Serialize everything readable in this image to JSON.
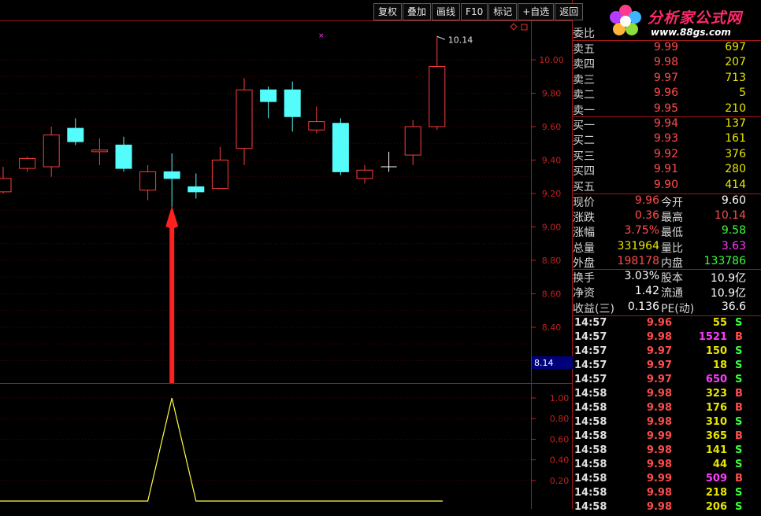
{
  "toolbar": {
    "buttons": [
      "复权",
      "叠加",
      "画线",
      "F10",
      "标记",
      "+自选",
      "返回"
    ]
  },
  "logo": {
    "title": "分析家公式网",
    "url": "www.88gs.com"
  },
  "colors": {
    "up": "#ff3c3c",
    "down": "#54fcfc",
    "grid": "#5a0000",
    "axis": "#c02020",
    "indicator": "#ffff40",
    "arrow": "#ff2020"
  },
  "main_chart": {
    "price_axis_ticks": [
      "10.00",
      "9.80",
      "9.60",
      "9.40",
      "9.20",
      "9.00",
      "8.80",
      "8.60",
      "8.40"
    ],
    "high_label": "10.14",
    "cursor_value": "8.14",
    "candles": [
      {
        "o": 9.21,
        "h": 9.36,
        "l": 9.2,
        "c": 9.29
      },
      {
        "o": 9.35,
        "h": 9.42,
        "l": 9.33,
        "c": 9.41
      },
      {
        "o": 9.36,
        "h": 9.6,
        "l": 9.3,
        "c": 9.55
      },
      {
        "o": 9.59,
        "h": 9.65,
        "l": 9.49,
        "c": 9.51
      },
      {
        "o": 9.45,
        "h": 9.53,
        "l": 9.37,
        "c": 9.46
      },
      {
        "o": 9.49,
        "h": 9.54,
        "l": 9.33,
        "c": 9.35
      },
      {
        "o": 9.22,
        "h": 9.37,
        "l": 9.16,
        "c": 9.33
      },
      {
        "o": 9.33,
        "h": 9.44,
        "l": 9.1,
        "c": 9.29
      },
      {
        "o": 9.24,
        "h": 9.32,
        "l": 9.17,
        "c": 9.21
      },
      {
        "o": 9.23,
        "h": 9.48,
        "l": 9.23,
        "c": 9.4
      },
      {
        "o": 9.47,
        "h": 9.89,
        "l": 9.37,
        "c": 9.82
      },
      {
        "o": 9.82,
        "h": 9.84,
        "l": 9.65,
        "c": 9.75
      },
      {
        "o": 9.82,
        "h": 9.87,
        "l": 9.57,
        "c": 9.66
      },
      {
        "o": 9.58,
        "h": 9.72,
        "l": 9.56,
        "c": 9.63
      },
      {
        "o": 9.62,
        "h": 9.65,
        "l": 9.31,
        "c": 9.33
      },
      {
        "o": 9.29,
        "h": 9.37,
        "l": 9.26,
        "c": 9.34
      },
      {
        "o": 9.36,
        "h": 9.45,
        "l": 9.33,
        "c": 9.36
      },
      {
        "o": 9.43,
        "h": 9.64,
        "l": 9.37,
        "c": 9.6
      },
      {
        "o": 9.6,
        "h": 10.14,
        "l": 9.58,
        "c": 9.96
      }
    ]
  },
  "indicator": {
    "axis_ticks": [
      "1.00",
      "0.80",
      "0.60",
      "0.40",
      "0.20"
    ],
    "values": [
      0,
      0,
      0,
      0,
      0,
      0,
      0,
      1,
      0,
      0,
      0,
      0,
      0,
      0,
      0,
      0,
      0,
      0,
      0
    ]
  },
  "quote": {
    "weibi_label": "委比",
    "asks": [
      {
        "label": "卖五",
        "price": "9.99",
        "vol": "697"
      },
      {
        "label": "卖四",
        "price": "9.98",
        "vol": "207"
      },
      {
        "label": "卖三",
        "price": "9.97",
        "vol": "713"
      },
      {
        "label": "卖二",
        "price": "9.96",
        "vol": "5"
      },
      {
        "label": "卖一",
        "price": "9.95",
        "vol": "210"
      }
    ],
    "bids": [
      {
        "label": "买一",
        "price": "9.94",
        "vol": "137"
      },
      {
        "label": "买二",
        "price": "9.93",
        "vol": "161"
      },
      {
        "label": "买三",
        "price": "9.92",
        "vol": "376"
      },
      {
        "label": "买四",
        "price": "9.91",
        "vol": "280"
      },
      {
        "label": "买五",
        "price": "9.90",
        "vol": "414"
      }
    ],
    "stats1": [
      {
        "l1": "现价",
        "v1": "9.96",
        "c1": "red",
        "l2": "今开",
        "v2": "9.60",
        "c2": "white"
      },
      {
        "l1": "涨跌",
        "v1": "0.36",
        "c1": "red",
        "l2": "最高",
        "v2": "10.14",
        "c2": "red"
      },
      {
        "l1": "涨幅",
        "v1": "3.75%",
        "c1": "red",
        "l2": "最低",
        "v2": "9.58",
        "c2": "green"
      },
      {
        "l1": "总量",
        "v1": "331964",
        "c1": "yellow",
        "l2": "量比",
        "v2": "3.63",
        "c2": "magenta"
      },
      {
        "l1": "外盘",
        "v1": "198178",
        "c1": "red",
        "l2": "内盘",
        "v2": "133786",
        "c2": "green"
      }
    ],
    "stats2": [
      {
        "l1": "换手",
        "v1": "3.03%",
        "c1": "white",
        "l2": "股本",
        "v2": "10.9亿",
        "c2": "white"
      },
      {
        "l1": "净资",
        "v1": "1.42",
        "c1": "white",
        "l2": "流通",
        "v2": "10.9亿",
        "c2": "white"
      },
      {
        "l1": "收益(三)",
        "v1": "0.136",
        "c1": "white",
        "l2": "PE(动)",
        "v2": "36.6",
        "c2": "white"
      }
    ],
    "ticks": [
      {
        "time": "14:57",
        "price": "9.96",
        "vol": "55",
        "side": "S"
      },
      {
        "time": "14:57",
        "price": "9.98",
        "vol": "1521",
        "side": "B"
      },
      {
        "time": "14:57",
        "price": "9.97",
        "vol": "150",
        "side": "S"
      },
      {
        "time": "14:57",
        "price": "9.97",
        "vol": "18",
        "side": "S"
      },
      {
        "time": "14:57",
        "price": "9.97",
        "vol": "650",
        "side": "S"
      },
      {
        "time": "14:58",
        "price": "9.98",
        "vol": "323",
        "side": "B"
      },
      {
        "time": "14:58",
        "price": "9.98",
        "vol": "176",
        "side": "B"
      },
      {
        "time": "14:58",
        "price": "9.98",
        "vol": "310",
        "side": "S"
      },
      {
        "time": "14:58",
        "price": "9.99",
        "vol": "365",
        "side": "B"
      },
      {
        "time": "14:58",
        "price": "9.98",
        "vol": "141",
        "side": "S"
      },
      {
        "time": "14:58",
        "price": "9.98",
        "vol": "44",
        "side": "S"
      },
      {
        "time": "14:58",
        "price": "9.99",
        "vol": "509",
        "side": "B"
      },
      {
        "time": "14:58",
        "price": "9.98",
        "vol": "218",
        "side": "S"
      },
      {
        "time": "14:58",
        "price": "9.98",
        "vol": "206",
        "side": "S"
      }
    ]
  }
}
